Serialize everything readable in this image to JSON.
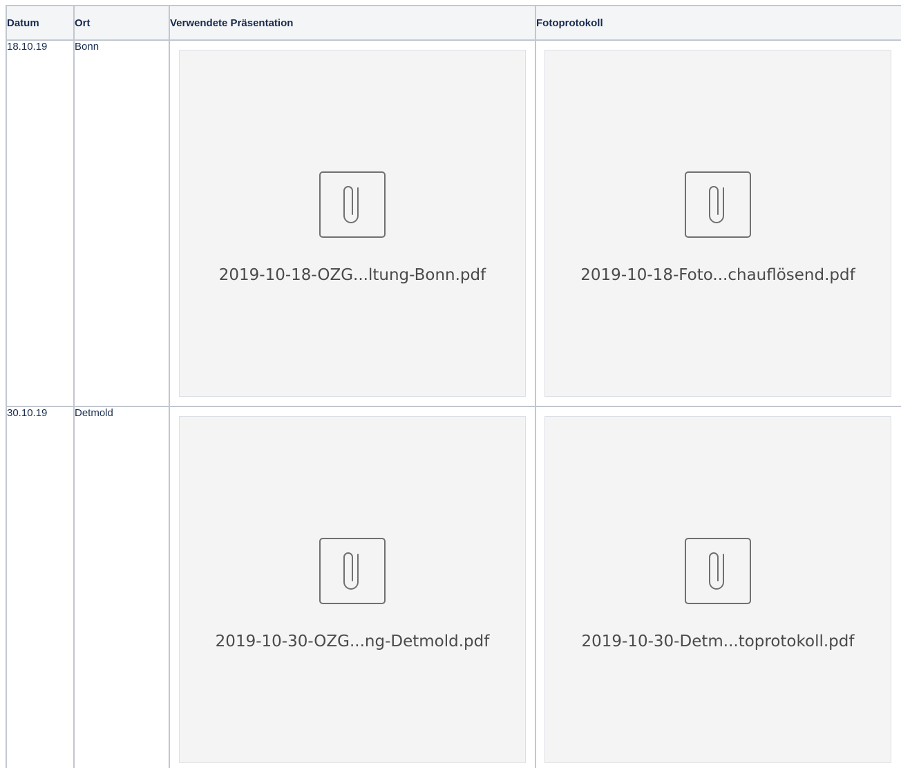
{
  "table": {
    "headers": {
      "datum": "Datum",
      "ort": "Ort",
      "presentation": "Verwendete Präsentation",
      "photo_protocol": "Fotoprotokoll"
    },
    "rows": [
      {
        "datum": "18.10.19",
        "ort": "Bonn",
        "presentation_file": "2019-10-18-OZG...ltung-Bonn.pdf",
        "photo_file": "2019-10-18-Foto...chauflösend.pdf"
      },
      {
        "datum": "30.10.19",
        "ort": "Detmold",
        "presentation_file": "2019-10-30-OZG...ng-Detmold.pdf",
        "photo_file": "2019-10-30-Detm...toprotokoll.pdf"
      }
    ]
  },
  "icons": {
    "attachment": "paperclip-icon"
  },
  "colors": {
    "header_bg": "#f4f5f7",
    "border": "#c1c7d0",
    "card_bg": "#f4f4f4",
    "icon_stroke": "#707070"
  }
}
